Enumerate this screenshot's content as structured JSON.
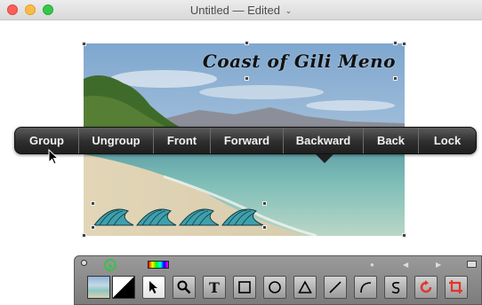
{
  "window": {
    "title": "Untitled — Edited",
    "title_chevron": "⌄"
  },
  "photo": {
    "caption": "Coast of Gili Meno"
  },
  "context_menu": {
    "items": [
      {
        "label": "Group"
      },
      {
        "label": "Ungroup"
      },
      {
        "label": "Front"
      },
      {
        "label": "Forward"
      },
      {
        "label": "Backward"
      },
      {
        "label": "Back"
      },
      {
        "label": "Lock"
      }
    ]
  },
  "palette": {
    "tools": [
      {
        "name": "arrow",
        "icon": "arrow-icon",
        "active": true
      },
      {
        "name": "zoom",
        "icon": "magnifier-icon"
      },
      {
        "name": "text",
        "icon": "text-icon",
        "glyph": "T"
      },
      {
        "name": "rectangle",
        "icon": "rectangle-icon"
      },
      {
        "name": "ellipse",
        "icon": "circle-icon"
      },
      {
        "name": "polygon",
        "icon": "triangle-icon"
      },
      {
        "name": "line",
        "icon": "line-icon"
      },
      {
        "name": "arc",
        "icon": "arc-icon"
      },
      {
        "name": "freehand",
        "icon": "freehand-icon"
      },
      {
        "name": "rotate",
        "icon": "rotate-icon"
      },
      {
        "name": "crop",
        "icon": "crop-icon"
      }
    ]
  },
  "colors": {
    "accent_green": "#3cc04f",
    "rotate_red": "#e2352b"
  }
}
